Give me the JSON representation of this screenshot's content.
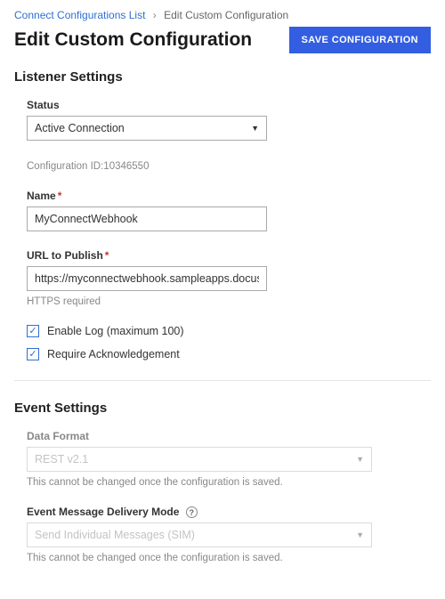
{
  "breadcrumb": {
    "parent": "Connect Configurations List",
    "separator": "›",
    "current": "Edit Custom Configuration"
  },
  "title": "Edit Custom Configuration",
  "actions": {
    "save_label": "SAVE CONFIGURATION"
  },
  "listener": {
    "heading": "Listener Settings",
    "status": {
      "label": "Status",
      "value": "Active Connection"
    },
    "config_id": {
      "label": "Configuration ID:",
      "value": "10346550"
    },
    "name": {
      "label": "Name",
      "value": "MyConnectWebhook"
    },
    "url": {
      "label": "URL to Publish",
      "value": "https://myconnectwebhook.sampleapps.docusign.com/a",
      "helper": "HTTPS required"
    },
    "enable_log": {
      "label": "Enable Log (maximum 100)",
      "checked": true
    },
    "require_ack": {
      "label": "Require Acknowledgement",
      "checked": true
    }
  },
  "event": {
    "heading": "Event Settings",
    "data_format": {
      "label": "Data Format",
      "value": "REST v2.1",
      "helper": "This cannot be changed once the configuration is saved."
    },
    "delivery_mode": {
      "label": "Event Message Delivery Mode",
      "value": "Send Individual Messages (SIM)",
      "helper": "This cannot be changed once the configuration is saved."
    }
  }
}
